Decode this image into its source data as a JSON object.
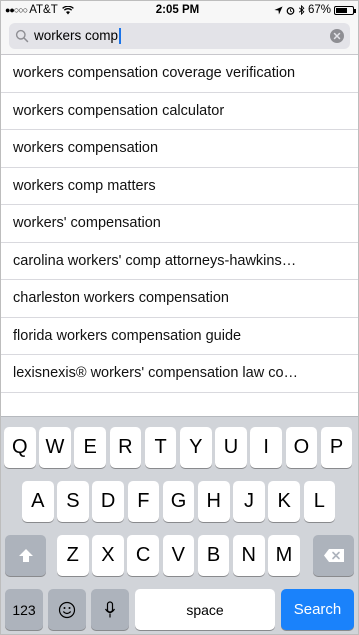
{
  "status_bar": {
    "signal_dots": "●●○○○",
    "carrier": "AT&T",
    "wifi_icon": "wifi-icon",
    "time": "2:05 PM",
    "battery_percent": "67%",
    "battery_level": 0.67
  },
  "search": {
    "query": "workers comp"
  },
  "suggestions": [
    "workers compensation coverage verification",
    "workers compensation calculator",
    "workers compensation",
    "workers comp matters",
    "workers' compensation",
    "carolina workers' comp attorneys-hawkins…",
    "charleston workers compensation",
    "florida workers compensation guide",
    "lexisnexis® workers' compensation law co…"
  ],
  "keyboard": {
    "row1": [
      "Q",
      "W",
      "E",
      "R",
      "T",
      "Y",
      "U",
      "I",
      "O",
      "P"
    ],
    "row2": [
      "A",
      "S",
      "D",
      "F",
      "G",
      "H",
      "J",
      "K",
      "L"
    ],
    "row3": [
      "Z",
      "X",
      "C",
      "V",
      "B",
      "N",
      "M"
    ],
    "numbers_label": "123",
    "space_label": "space",
    "search_label": "Search"
  },
  "colors": {
    "search_key": "#1a82fb",
    "keyboard_bg": "#d1d4d9"
  }
}
